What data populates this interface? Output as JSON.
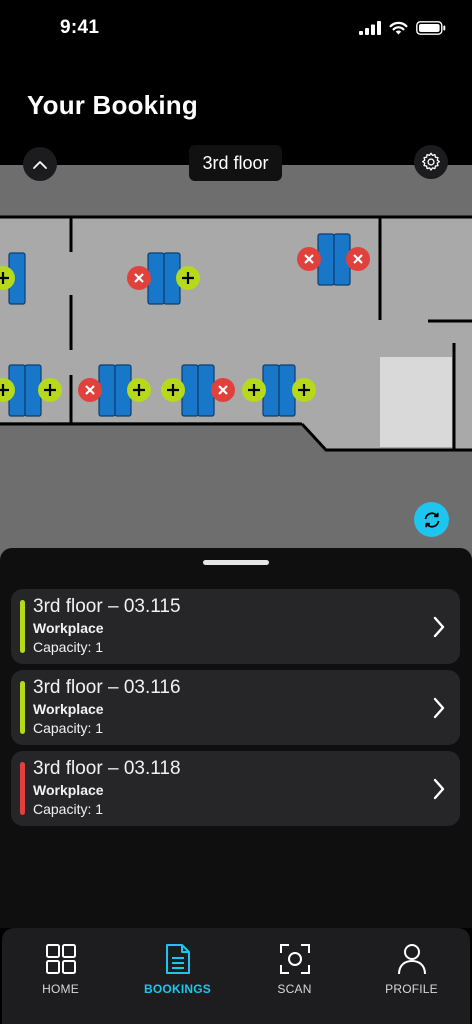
{
  "status_bar": {
    "time": "9:41"
  },
  "page": {
    "title": "Your Booking"
  },
  "map": {
    "floor_label": "3rd floor"
  },
  "colors": {
    "accent": "#1ec5ee",
    "available": "#b6d91c",
    "occupied": "#e0413c",
    "desk": "#1877c9"
  },
  "bookings": [
    {
      "title": "3rd floor – 03.115",
      "type": "Workplace",
      "capacity": "Capacity: 1",
      "status": "available"
    },
    {
      "title": "3rd floor – 03.116",
      "type": "Workplace",
      "capacity": "Capacity: 1",
      "status": "available"
    },
    {
      "title": "3rd floor – 03.118",
      "type": "Workplace",
      "capacity": "Capacity: 1",
      "status": "occupied"
    }
  ],
  "tabs": [
    {
      "label": "HOME",
      "icon": "grid-icon",
      "active": false
    },
    {
      "label": "BOOKINGS",
      "icon": "document-icon",
      "active": true
    },
    {
      "label": "SCAN",
      "icon": "scan-icon",
      "active": false
    },
    {
      "label": "PROFILE",
      "icon": "person-icon",
      "active": false
    }
  ]
}
